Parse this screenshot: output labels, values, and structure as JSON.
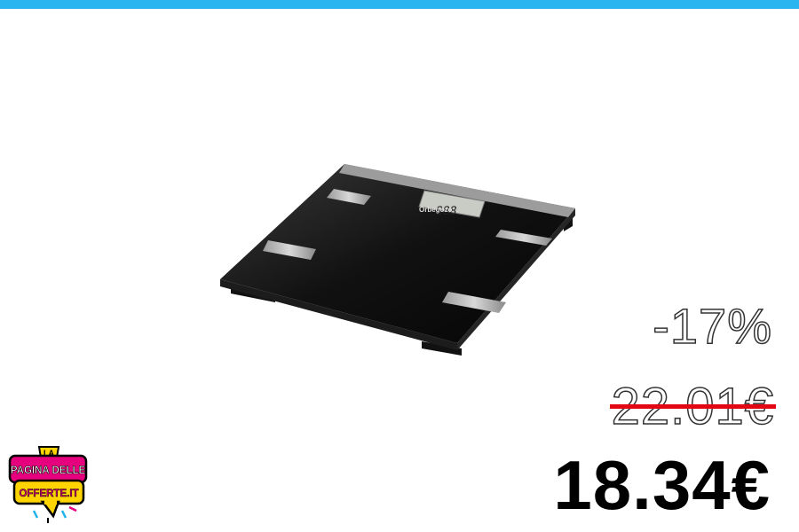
{
  "colors": {
    "top_bar": "#2bb5f0",
    "strike": "#e30613",
    "logo_pink": "#e6007e",
    "logo_yellow": "#ffd400",
    "logo_cyan": "#1fb4e6"
  },
  "product": {
    "brand_label": "Orbegozo",
    "display_text": "888"
  },
  "pricing": {
    "discount": "-17%",
    "old_price": "22.01€",
    "new_price": "18.34€"
  },
  "logo": {
    "line1": "LA",
    "line2": "PAGINA DELLE",
    "line3": "OFFERTE.IT"
  }
}
